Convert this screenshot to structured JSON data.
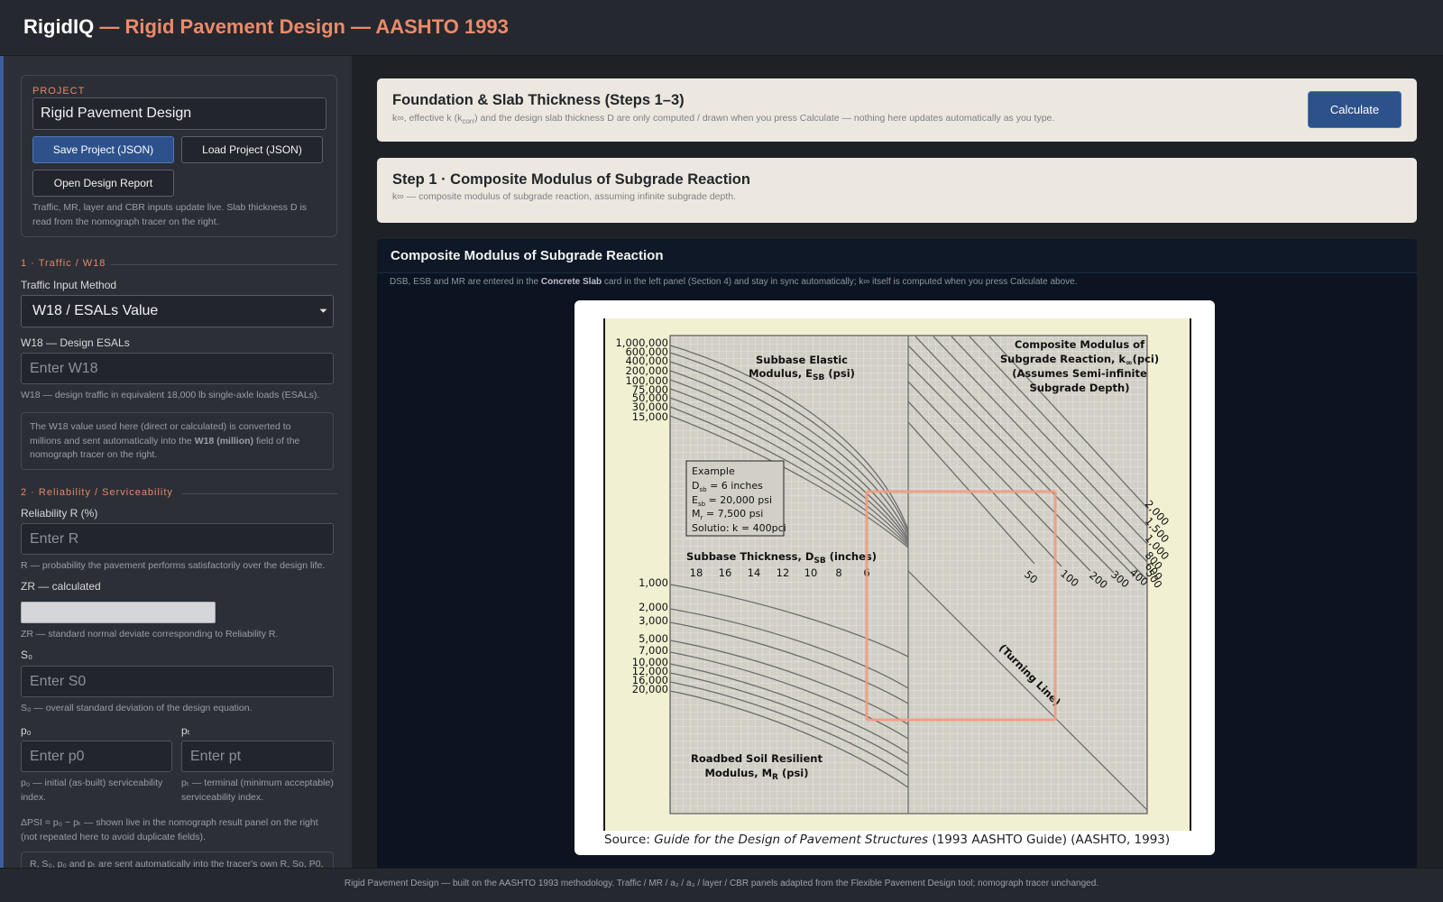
{
  "header": {
    "brand": "RigidIQ",
    "subtitle": " — Rigid Pavement Design — AASHTO 1993"
  },
  "sidebar": {
    "project": {
      "kicker": "PROJECT",
      "name_value": "Rigid Pavement Design",
      "save_label": "Save Project (JSON)",
      "load_label": "Load Project (JSON)",
      "report_label": "Open Design Report",
      "hint": "Traffic, MR, layer and CBR inputs update live. Slab thickness D is read from the nomograph tracer on the right."
    },
    "traffic": {
      "heading": "1 · Traffic / W18",
      "method_label": "Traffic Input Method",
      "method_value": "W18 / ESALs Value",
      "w18_label": "W18 — Design ESALs",
      "w18_placeholder": "Enter W18",
      "w18_hint": "W18 — design traffic in equivalent 18,000 lb single-axle loads (ESALs).",
      "info_pre": "The W18 value used here (direct or calculated) is converted to millions and sent automatically into the ",
      "info_bold": "W18 (million)",
      "info_post": " field of the nomograph tracer on the right."
    },
    "reliability": {
      "heading": "2 · Reliability / Serviceability",
      "r_label": "Reliability R (%)",
      "r_placeholder": "Enter R",
      "r_hint": "R — probability the pavement performs satisfactorily over the design life.",
      "zr_label": "ZR — calculated",
      "zr_hint": "ZR — standard normal deviate corresponding to Reliability R.",
      "s0_label": "S₀",
      "s0_placeholder": "Enter S0",
      "s0_hint": "S₀ — overall standard deviation of the design equation.",
      "p0_label": "p₀",
      "p0_placeholder": "Enter p0",
      "p0_hint": "p₀ — initial (as-built) serviceability index.",
      "pt_label": "pₜ",
      "pt_placeholder": "Enter pt",
      "pt_hint": "pₜ — terminal (minimum acceptable) serviceability index.",
      "dpsi_hint": "ΔPSI = p₀ − pₜ — shown live in the nomograph result panel on the right (not repeated here to avoid duplicate fields).",
      "sync_hint": "R, S₀, p₀ and pₜ are sent automatically into the tracer's own R, So, P0, Pt"
    }
  },
  "main": {
    "foundation": {
      "title": "Foundation & Slab Thickness (Steps 1–3)",
      "sub_a": "k∞, effective k (k",
      "sub_sub": "corr",
      "sub_b": ") and the design slab thickness D are only computed / drawn when you press Calculate — nothing here updates automatically as you type.",
      "calculate_label": "Calculate"
    },
    "step1": {
      "title": "Step 1 · Composite Modulus of Subgrade Reaction",
      "sub": "k∞ — composite modulus of subgrade reaction, assuming infinite subgrade depth."
    },
    "composite": {
      "title": "Composite Modulus of Subgrade Reaction",
      "sub_a": "DSB, ESB and MR are entered in the ",
      "sub_bold": "Concrete Slab",
      "sub_b": " card in the left panel (Section 4) and stay in sync automatically; k∞ itself is computed when you press Calculate above."
    },
    "nomograph": {
      "esb_ticks": [
        "1,000,000",
        "600,000",
        "400,000",
        "200,000",
        "100,000",
        "75,000",
        "50,000",
        "30,000",
        "15,000"
      ],
      "esb_title_1": "Subbase Elastic",
      "esb_title_2": "Modulus, E",
      "esb_title_sub": "SB",
      "esb_title_unit": " (psi)",
      "k_title_1": "Composite Modulus of",
      "k_title_2": "Subgrade Reaction, k",
      "k_title_sub": "∞",
      "k_title_unit": "(pci)",
      "k_title_3": "(Assumes Semi-infinite",
      "k_title_4": "Subgrade Depth)",
      "example_title": "Example",
      "example_dsb": " = 6 inches",
      "example_esb": " = 20,000 psi",
      "example_mr": " = 7,500 psi",
      "example_sol": "Solutio: k = 400pci",
      "dsb_title_a": "Subbase Thickness, D",
      "dsb_title_sub": "SB",
      "dsb_title_unit": " (inches)",
      "dsb_ticks": [
        "18",
        "16",
        "14",
        "12",
        "10",
        "8",
        "6"
      ],
      "mr_ticks": [
        "1,000",
        "2,000",
        "3,000",
        "5,000",
        "7,000",
        "10,000",
        "12,000",
        "16,000",
        "20,000"
      ],
      "k_ticks_lower": [
        "50",
        "100",
        "200",
        "300",
        "400",
        "500"
      ],
      "k_ticks_upper": [
        "2,000",
        "1,500",
        "1,000",
        "800",
        "600"
      ],
      "turning_line": "(Turning Line)",
      "mr_title_1": "Roadbed Soil Resilient",
      "mr_title_2": "Modulus, M",
      "mr_title_sub": "R",
      "mr_title_unit": " (psi)",
      "source_pre": "Source: ",
      "source_italic": "Guide for the Design of Pavement Structures",
      "source_post": " (1993 AASHTO Guide) (AASHTO, 1993)"
    }
  },
  "footer": {
    "text": "Rigid Pavement Design — built on the AASHTO 1993 methodology. Traffic / MR / a₂ / a₃ / layer / CBR panels adapted from the Flexible Pavement Design tool; nomograph tracer unchanged."
  },
  "colors": {
    "accent": "#e5876a",
    "primary_button": "#2d518b",
    "trace": "#f39a82"
  }
}
